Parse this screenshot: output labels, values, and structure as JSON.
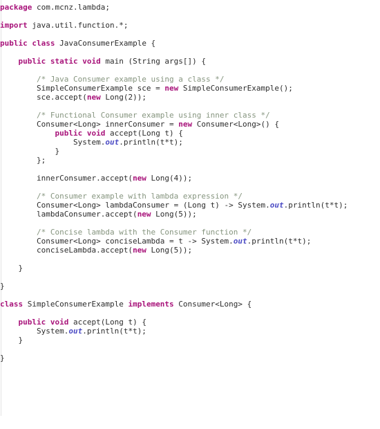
{
  "editor": {
    "language": "java",
    "background_color": "#ffffff",
    "gutter_rule_color": "#e3e3e3"
  },
  "syntax_colors": {
    "keyword": "#a8137a",
    "comment": "#86957f",
    "field": "#4b4bc4",
    "text": "#2b2b2b"
  },
  "code": {
    "lines": [
      {
        "indent": 0,
        "tokens": [
          {
            "t": "kw",
            "s": "package"
          },
          {
            "t": "txt",
            "s": " com.mcnz.lambda;"
          }
        ]
      },
      {
        "indent": 0,
        "tokens": []
      },
      {
        "indent": 0,
        "tokens": [
          {
            "t": "kw",
            "s": "import"
          },
          {
            "t": "txt",
            "s": " java.util.function.*;"
          }
        ]
      },
      {
        "indent": 0,
        "tokens": []
      },
      {
        "indent": 0,
        "tokens": [
          {
            "t": "kw",
            "s": "public class"
          },
          {
            "t": "txt",
            "s": " JavaConsumerExample {"
          }
        ]
      },
      {
        "indent": 0,
        "tokens": []
      },
      {
        "indent": 1,
        "tokens": [
          {
            "t": "kw",
            "s": "public static void"
          },
          {
            "t": "txt",
            "s": " main (String args[]) {"
          }
        ]
      },
      {
        "indent": 0,
        "tokens": []
      },
      {
        "indent": 2,
        "tokens": [
          {
            "t": "cm",
            "s": "/* Java Consumer example using a class */"
          }
        ]
      },
      {
        "indent": 2,
        "tokens": [
          {
            "t": "txt",
            "s": "SimpleConsumerExample sce = "
          },
          {
            "t": "kw",
            "s": "new"
          },
          {
            "t": "txt",
            "s": " SimpleConsumerExample();"
          }
        ]
      },
      {
        "indent": 2,
        "tokens": [
          {
            "t": "txt",
            "s": "sce.accept("
          },
          {
            "t": "kw",
            "s": "new"
          },
          {
            "t": "txt",
            "s": " Long(2));"
          }
        ]
      },
      {
        "indent": 0,
        "tokens": []
      },
      {
        "indent": 2,
        "tokens": [
          {
            "t": "cm",
            "s": "/* Functional Consumer example using inner class */"
          }
        ]
      },
      {
        "indent": 2,
        "tokens": [
          {
            "t": "txt",
            "s": "Consumer<Long> innerConsumer = "
          },
          {
            "t": "kw",
            "s": "new"
          },
          {
            "t": "txt",
            "s": " Consumer<Long>() {"
          }
        ]
      },
      {
        "indent": 3,
        "tokens": [
          {
            "t": "kw",
            "s": "public void"
          },
          {
            "t": "txt",
            "s": " accept(Long t) {"
          }
        ]
      },
      {
        "indent": 4,
        "tokens": [
          {
            "t": "txt",
            "s": "System."
          },
          {
            "t": "fld",
            "s": "out"
          },
          {
            "t": "txt",
            "s": ".println(t*t);"
          }
        ]
      },
      {
        "indent": 3,
        "tokens": [
          {
            "t": "txt",
            "s": "}"
          }
        ]
      },
      {
        "indent": 2,
        "tokens": [
          {
            "t": "txt",
            "s": "};"
          }
        ]
      },
      {
        "indent": 0,
        "tokens": []
      },
      {
        "indent": 2,
        "tokens": [
          {
            "t": "txt",
            "s": "innerConsumer.accept("
          },
          {
            "t": "kw",
            "s": "new"
          },
          {
            "t": "txt",
            "s": " Long(4));"
          }
        ]
      },
      {
        "indent": 0,
        "tokens": []
      },
      {
        "indent": 2,
        "tokens": [
          {
            "t": "cm",
            "s": "/* Consumer example with lambda expression */"
          }
        ]
      },
      {
        "indent": 2,
        "tokens": [
          {
            "t": "txt",
            "s": "Consumer<Long> lambdaConsumer = (Long t) -> System."
          },
          {
            "t": "fld",
            "s": "out"
          },
          {
            "t": "txt",
            "s": ".println(t*t);"
          }
        ]
      },
      {
        "indent": 2,
        "tokens": [
          {
            "t": "txt",
            "s": "lambdaConsumer.accept("
          },
          {
            "t": "kw",
            "s": "new"
          },
          {
            "t": "txt",
            "s": " Long(5));"
          }
        ]
      },
      {
        "indent": 0,
        "tokens": []
      },
      {
        "indent": 2,
        "tokens": [
          {
            "t": "cm",
            "s": "/* Concise lambda with the Consumer function */"
          }
        ]
      },
      {
        "indent": 2,
        "tokens": [
          {
            "t": "txt",
            "s": "Consumer<Long> conciseLambda = t -> System."
          },
          {
            "t": "fld",
            "s": "out"
          },
          {
            "t": "txt",
            "s": ".println(t*t);"
          }
        ]
      },
      {
        "indent": 2,
        "tokens": [
          {
            "t": "txt",
            "s": "conciseLambda.accept("
          },
          {
            "t": "kw",
            "s": "new"
          },
          {
            "t": "txt",
            "s": " Long(5));"
          }
        ]
      },
      {
        "indent": 0,
        "tokens": []
      },
      {
        "indent": 1,
        "tokens": [
          {
            "t": "txt",
            "s": "}"
          }
        ]
      },
      {
        "indent": 0,
        "tokens": []
      },
      {
        "indent": 0,
        "tokens": [
          {
            "t": "txt",
            "s": "}"
          }
        ]
      },
      {
        "indent": 0,
        "tokens": []
      },
      {
        "indent": 0,
        "tokens": [
          {
            "t": "kw",
            "s": "class"
          },
          {
            "t": "txt",
            "s": " SimpleConsumerExample "
          },
          {
            "t": "kw",
            "s": "implements"
          },
          {
            "t": "txt",
            "s": " Consumer<Long> {"
          }
        ]
      },
      {
        "indent": 0,
        "tokens": []
      },
      {
        "indent": 1,
        "tokens": [
          {
            "t": "kw",
            "s": "public void"
          },
          {
            "t": "txt",
            "s": " accept(Long t) {"
          }
        ]
      },
      {
        "indent": 2,
        "tokens": [
          {
            "t": "txt",
            "s": "System."
          },
          {
            "t": "fld",
            "s": "out"
          },
          {
            "t": "txt",
            "s": ".println(t*t);"
          }
        ]
      },
      {
        "indent": 1,
        "tokens": [
          {
            "t": "txt",
            "s": "}"
          }
        ]
      },
      {
        "indent": 0,
        "tokens": []
      },
      {
        "indent": 0,
        "tokens": [
          {
            "t": "txt",
            "s": "}"
          }
        ]
      }
    ]
  }
}
